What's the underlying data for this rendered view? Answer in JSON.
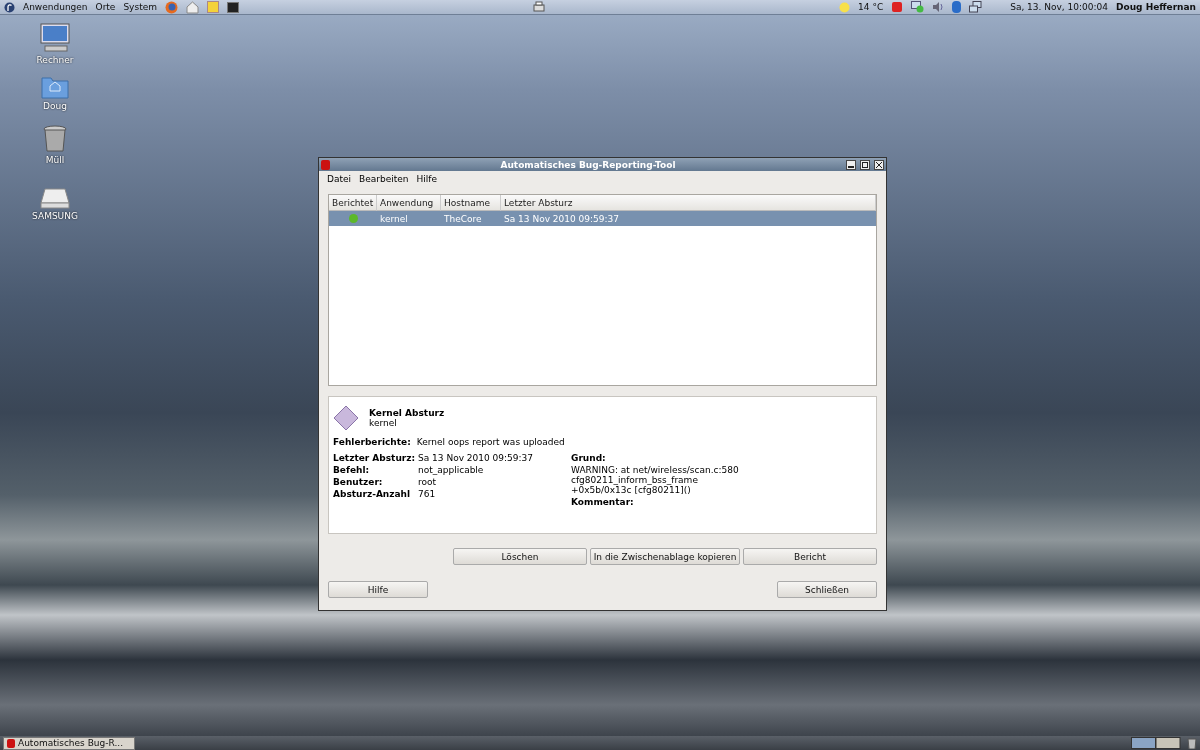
{
  "top_panel": {
    "menus": [
      "Anwendungen",
      "Orte",
      "System"
    ],
    "weather": "14 °C",
    "clock": "Sa, 13. Nov, 10:00:04",
    "user": "Doug Heffernan"
  },
  "desktop_icons": [
    {
      "label": "Rechner",
      "kind": "computer"
    },
    {
      "label": "Doug",
      "kind": "home"
    },
    {
      "label": "Müll",
      "kind": "trash"
    },
    {
      "label": "SAMSUNG",
      "kind": "drive"
    }
  ],
  "window": {
    "title": "Automatisches Bug-Reporting-Tool",
    "menu": [
      "Datei",
      "Bearbeiten",
      "Hilfe"
    ],
    "table": {
      "columns": [
        "Berichtet",
        "Anwendung",
        "Hostname",
        "Letzter Absturz"
      ],
      "rows": [
        {
          "reported": true,
          "application": "kernel",
          "hostname": "TheCore",
          "last_crash": "Sa 13 Nov 2010 09:59:37",
          "selected": true
        }
      ]
    },
    "details": {
      "title": "Kernel Absturz",
      "subtitle": "kernel",
      "reports_label": "Fehlerberichte:",
      "reports_value": "Kernel oops report was uploaded",
      "fields": [
        {
          "label": "Letzter Absturz:",
          "value": "Sa 13 Nov 2010 09:59:37"
        },
        {
          "label": "Befehl:",
          "value": "not_applicable"
        },
        {
          "label": "Benutzer:",
          "value": "root"
        },
        {
          "label": "Absturz-Anzahl",
          "value": "761"
        }
      ],
      "reason_label": "Grund:",
      "reason_lines": [
        "WARNING: at net/wireless/scan.c:580",
        "cfg80211_inform_bss_frame",
        "+0x5b/0x13c [cfg80211]()"
      ],
      "comment_label": "Kommentar:"
    },
    "actions": [
      "Löschen",
      "In die Zwischenablage kopieren",
      "Bericht"
    ],
    "footer_buttons": [
      "Hilfe",
      "Schließen"
    ]
  },
  "taskbar": {
    "items": [
      {
        "label": "Automatisches Bug-R...",
        "selected": false
      }
    ]
  }
}
